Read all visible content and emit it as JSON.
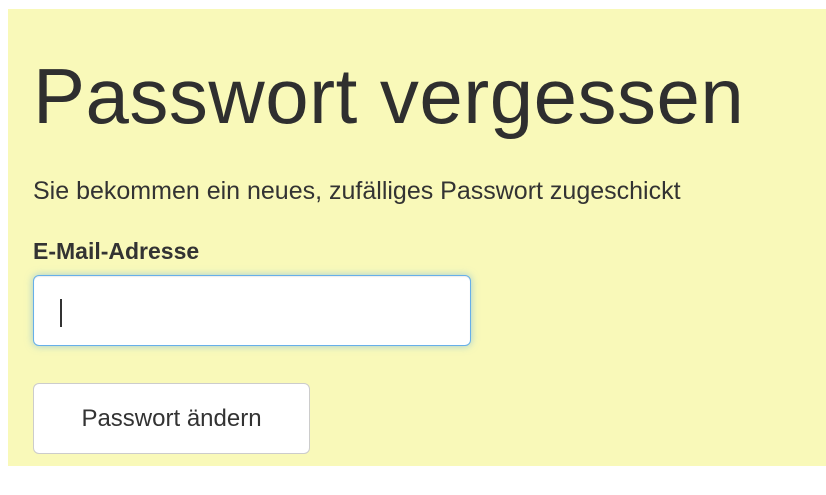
{
  "page": {
    "title": "Passwort vergessen",
    "subtitle": "Sie bekommen ein neues, zufälliges Passwort zugeschickt"
  },
  "form": {
    "email_label": "E-Mail-Adresse",
    "email_value": "",
    "submit_label": "Passwort ändern"
  },
  "colors": {
    "background": "#f9f9b9",
    "input_focus_border": "#66afe9",
    "text": "#333333"
  }
}
